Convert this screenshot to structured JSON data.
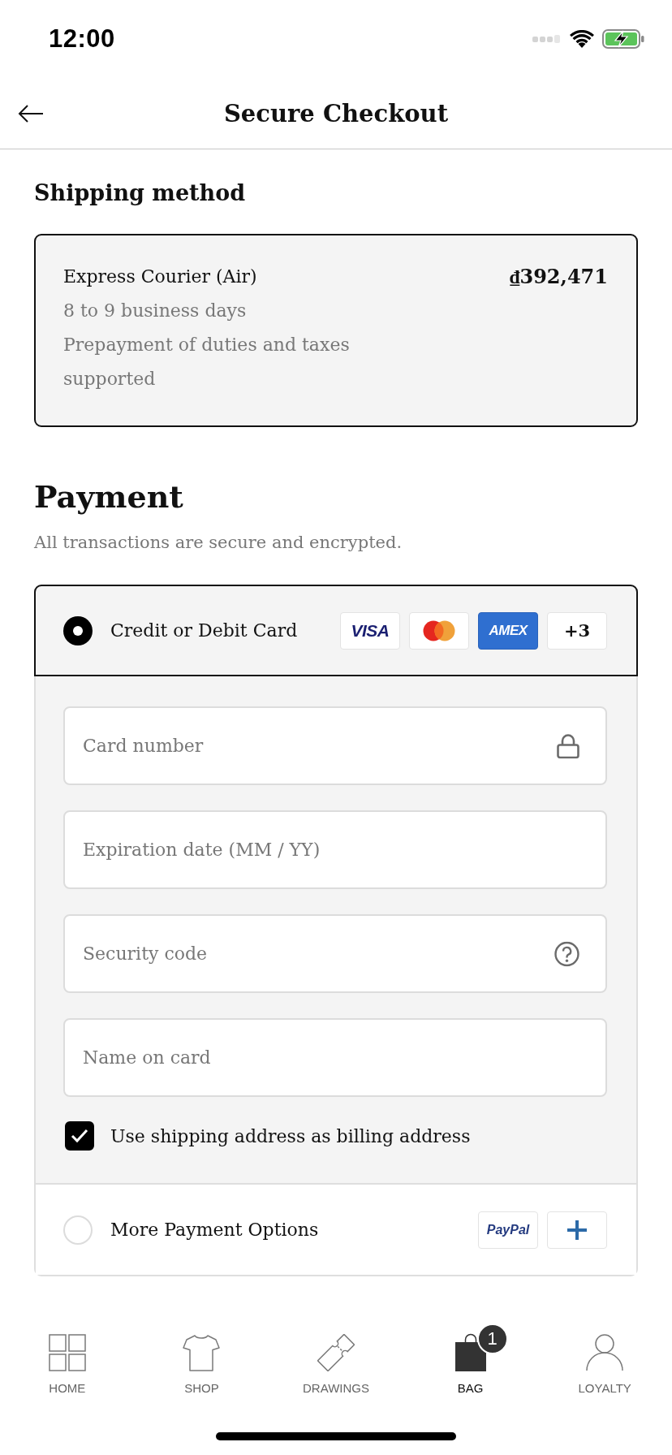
{
  "status_bar": {
    "time": "12:00"
  },
  "header": {
    "title": "Secure Checkout"
  },
  "shipping": {
    "heading": "Shipping method",
    "option": {
      "name": "Express Courier (Air)",
      "price": "₫392,471",
      "details": [
        "8 to 9 business days",
        "Prepayment of duties and taxes supported"
      ],
      "selected": true
    }
  },
  "payment": {
    "heading": "Payment",
    "subtitle": "All transactions are secure and encrypted.",
    "methods": [
      {
        "label": "Credit or Debit Card",
        "selected": true,
        "logos": [
          {
            "kind": "visa",
            "text": "VISA"
          },
          {
            "kind": "mastercard"
          },
          {
            "kind": "amex",
            "text": "AMEX"
          },
          {
            "kind": "count",
            "text": "+3"
          }
        ],
        "fields": [
          {
            "kind": "number",
            "placeholder": "Card number"
          },
          {
            "kind": "expiry",
            "placeholder": "Expiration date (MM / YY)"
          },
          {
            "kind": "security",
            "placeholder": "Security code"
          },
          {
            "kind": "name",
            "placeholder": "Name on card"
          }
        ],
        "billing": {
          "label": "Use shipping address as billing address",
          "checked": true
        }
      },
      {
        "label": "More Payment Options",
        "selected": false,
        "logos": [
          {
            "kind": "paypal",
            "text": "PayPal"
          },
          {
            "kind": "plus"
          }
        ]
      }
    ]
  },
  "tabs": [
    {
      "label": "HOME",
      "selected": false
    },
    {
      "label": "SHOP",
      "selected": false
    },
    {
      "label": "DRAWINGS",
      "selected": false
    },
    {
      "label": "BAG",
      "selected": true,
      "badge": "1"
    },
    {
      "label": "LOYALTY",
      "selected": false
    }
  ]
}
